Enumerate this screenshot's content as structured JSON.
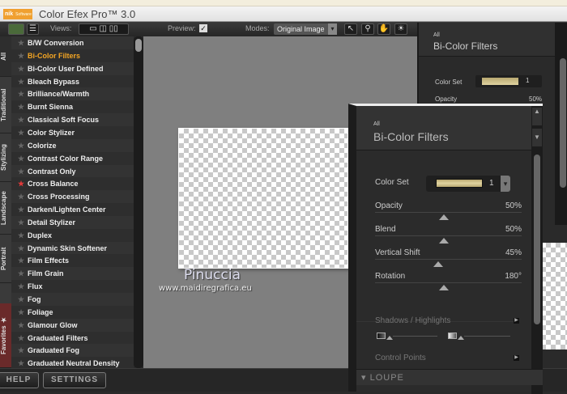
{
  "app": {
    "title": "Color Efex Pro™ 3.0",
    "logo": "nik Software"
  },
  "toolbar": {
    "views_label": "Views:",
    "preview_label": "Preview:",
    "preview_checked": true,
    "modes_label": "Modes:",
    "mode_value": "Original Image",
    "view_icons": [
      "single-view-icon",
      "split-view-icon",
      "side-by-side-icon"
    ],
    "tool_icons": [
      "arrow-tool-icon",
      "zoom-tool-icon",
      "hand-tool-icon",
      "light-tool-icon"
    ]
  },
  "side_tabs": [
    "All",
    "Traditional",
    "Stylizing",
    "Landscape",
    "Portrait",
    "Favorites"
  ],
  "filters": [
    "B/W Conversion",
    "Bi-Color Filters",
    "Bi-Color User Defined",
    "Bleach Bypass",
    "Brilliance/Warmth",
    "Burnt Sienna",
    "Classical Soft Focus",
    "Color Stylizer",
    "Colorize",
    "Contrast Color Range",
    "Contrast Only",
    "Cross Balance",
    "Cross Processing",
    "Darken/Lighten Center",
    "Detail Stylizer",
    "Duplex",
    "Dynamic Skin Softener",
    "Film Effects",
    "Film Grain",
    "Flux",
    "Fog",
    "Foliage",
    "Glamour Glow",
    "Graduated Filters",
    "Graduated Fog",
    "Graduated Neutral Density"
  ],
  "selected_filter": "Bi-Color Filters",
  "favorite_filter": "Cross Balance",
  "watermark": {
    "name": "Pinuccia",
    "url": "www.maidiregrafica.eu"
  },
  "bottom": {
    "help": "HELP",
    "settings": "SETTINGS"
  },
  "back_panel": {
    "category": "All",
    "title": "Bi-Color Filters",
    "color_set_label": "Color Set",
    "color_set_value": "1",
    "opacity_label": "Opacity",
    "opacity_value": "50%"
  },
  "panel": {
    "category": "All",
    "title": "Bi-Color Filters",
    "color_set_label": "Color Set",
    "color_set_value": "1",
    "sliders": [
      {
        "label": "Opacity",
        "value": "50%",
        "fraction": 0.5
      },
      {
        "label": "Blend",
        "value": "50%",
        "fraction": 0.5
      },
      {
        "label": "Vertical Shift",
        "value": "45%",
        "fraction": 0.45
      },
      {
        "label": "Rotation",
        "value": "180°",
        "fraction": 0.5
      }
    ],
    "shadows_highlights": "Shadows / Highlights",
    "control_points": "Control Points",
    "loupe": "LOUPE"
  },
  "colors": {
    "selected": "#f5a623",
    "favorite_star": "#e03a3a",
    "swatch": "#d8c998"
  }
}
